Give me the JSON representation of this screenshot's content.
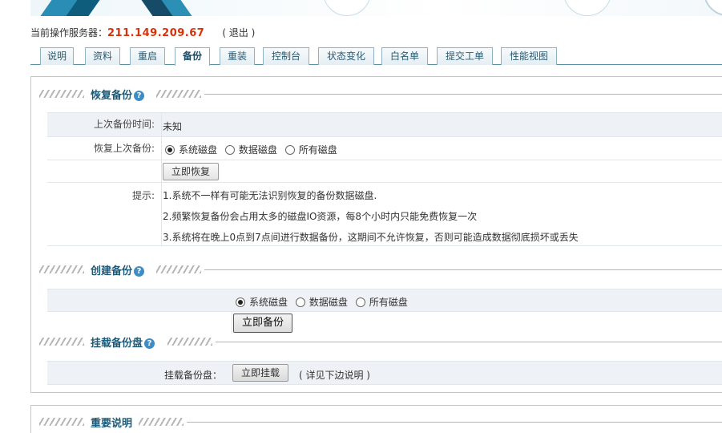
{
  "header": {
    "server_label": "当前操作服务器：",
    "server_ip": "211.149.209.67",
    "logout": "( 退出 )"
  },
  "tabs": [
    {
      "label": "说明"
    },
    {
      "label": "资料"
    },
    {
      "label": "重启"
    },
    {
      "label": "备份",
      "active": true
    },
    {
      "label": "重装"
    },
    {
      "label": "控制台"
    },
    {
      "label": "状态变化"
    },
    {
      "label": "白名单"
    },
    {
      "label": "提交工单"
    },
    {
      "label": "性能视图"
    }
  ],
  "restore": {
    "title": "恢复备份",
    "last_backup_label": "上次备份时间:",
    "last_backup_value": "未知",
    "restore_last_label": "恢复上次备份:",
    "options": [
      "系统磁盘",
      "数据磁盘",
      "所有磁盘"
    ],
    "selected": 0,
    "button": "立即恢复",
    "tips_label": "提示:",
    "tips": [
      "1.系统不一样有可能无法识别恢复的备份数据磁盘.",
      "2.频繁恢复备份会占用太多的磁盘IO资源，每8个小时内只能免费恢复一次",
      "3.系统将在晚上0点到7点间进行数据备份，这期间不允许恢复，否则可能造成数据彻底损坏或丢失"
    ]
  },
  "create": {
    "title": "创建备份",
    "options": [
      "系统磁盘",
      "数据磁盘",
      "所有磁盘"
    ],
    "selected": 0,
    "button": "立即备份"
  },
  "mount": {
    "title": "挂载备份盘",
    "label": "挂载备份盘：",
    "button": "立即挂载",
    "note": "( 详见下边说明 )"
  },
  "important": {
    "title": "重要说明"
  }
}
